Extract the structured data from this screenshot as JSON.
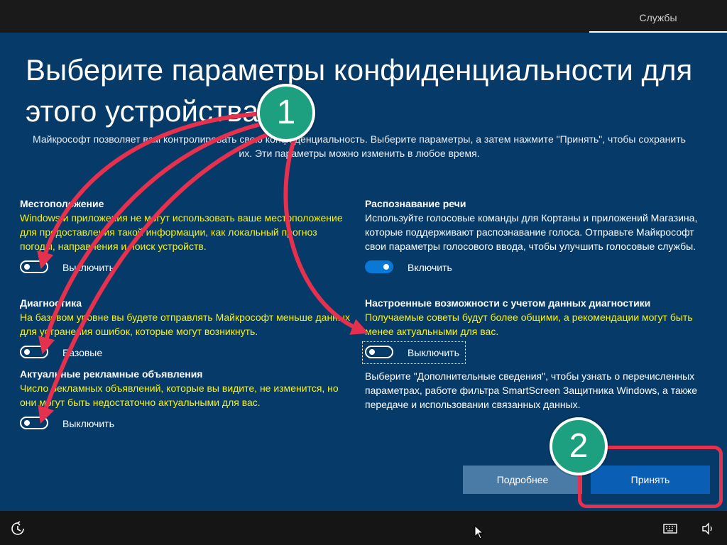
{
  "header": {
    "services_tab": "Службы"
  },
  "title": "Выберите параметры конфиденциальности для этого устройства",
  "subtitle": "Майкрософт позволяет вам контролировать свою конфиденциальность. Выберите параметры, а затем нажмите \"Принять\", чтобы сохранить их. Эти параметры можно изменить в любое время.",
  "settings": {
    "location": {
      "heading": "Местоположение",
      "description": "Windows и приложения не могут использовать ваше местоположение для предоставления такой информации, как локальный прогноз погоды, направления и поиск устройств.",
      "toggle_state": "off",
      "toggle_label": "Выключить"
    },
    "diagnostics": {
      "heading": "Диагностика",
      "description": "На базовом уровне вы будете отправлять  Майкрософт меньше данных для устранения ошибок, которые могут возникнуть.",
      "toggle_state": "off",
      "toggle_label": "Базовые"
    },
    "ads": {
      "heading": "Актуальные рекламные объявления",
      "description": "Число рекламных объявлений, которые вы видите, не изменится, но они могут быть недостаточно актуальными для вас.",
      "toggle_state": "off",
      "toggle_label": "Выключить"
    },
    "speech": {
      "heading": "Распознавание речи",
      "description": "Используйте голосовые команды для Кортаны и приложений Магазина, которые поддерживают распознавание голоса. Отправьте Майкрософт свои параметры голосового ввода, чтобы улучшить голосовые службы.",
      "toggle_state": "on",
      "toggle_label": "Включить"
    },
    "tailored": {
      "heading": "Настроенные возможности с учетом данных диагностики",
      "description": "Получаемые советы будут более общими, а рекомендации могут быть менее актуальными для вас.",
      "toggle_state": "off",
      "toggle_label": "Выключить"
    }
  },
  "info_text": "Выберите \"Дополнительные сведения\", чтобы узнать о перечисленных параметрах, работе фильтра SmartScreen Защитника Windows, а также передаче и использовании связанных данных.",
  "buttons": {
    "more": "Подробнее",
    "accept": "Принять"
  },
  "annotations": {
    "badge_1": "1",
    "badge_2": "2"
  },
  "colors": {
    "background": "#063a69",
    "highlight_text": "#fff200",
    "toggle_on": "#0a78d7",
    "accept_button": "#0a5fb4",
    "more_button": "#4a7ba7",
    "annotation_arrow": "#e5314d",
    "badge": "#1ca07f"
  },
  "taskbar": {
    "left_icon": "ease-of-access-icon",
    "right_icons": [
      "keyboard-icon",
      "volume-icon"
    ]
  }
}
